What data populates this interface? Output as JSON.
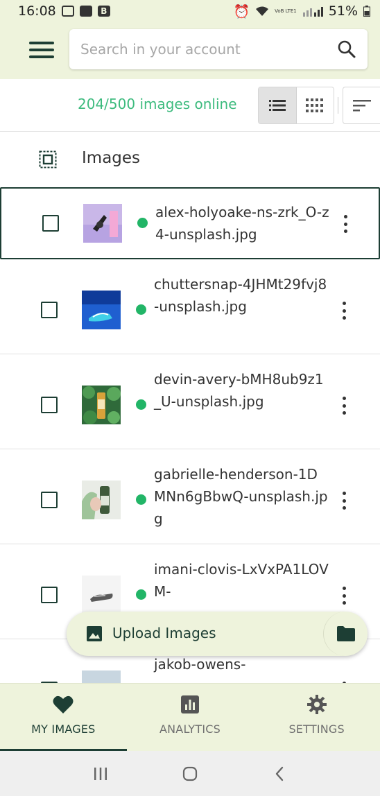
{
  "status_bar": {
    "time": "16:08",
    "signal_text": "VoB LTE1",
    "battery": "51%"
  },
  "header": {
    "search_placeholder": "Search in your account"
  },
  "toolbar": {
    "count_text": "204/500 images online"
  },
  "section": {
    "title": "Images"
  },
  "images": [
    {
      "name": "alex-holyoake-ns-zrk_O-z4-unsplash.jpg",
      "status": "online"
    },
    {
      "name": "chuttersnap-4JHMt29fvj8-unsplash.jpg",
      "status": "online"
    },
    {
      "name": "devin-avery-bMH8ub9z1_U-unsplash.jpg",
      "status": "online"
    },
    {
      "name": "gabrielle-henderson-1DMNn6gBbwQ-unsplash.jpg",
      "status": "online"
    },
    {
      "name": "imani-clovis-LxVxPA1LOVM-",
      "status": "online"
    },
    {
      "name": "jakob-owens-",
      "status": "online"
    }
  ],
  "fab": {
    "label": "Upload Images"
  },
  "bottom_nav": {
    "items": [
      {
        "label": "MY IMAGES",
        "icon": "heart-icon",
        "active": true
      },
      {
        "label": "ANALYTICS",
        "icon": "bar-chart-icon",
        "active": false
      },
      {
        "label": "SETTINGS",
        "icon": "gear-icon",
        "active": false
      }
    ]
  },
  "colors": {
    "accent": "#1d3e34",
    "online_green": "#22b567",
    "count_green": "#3dbb7e",
    "header_bg": "#eef3dc"
  }
}
